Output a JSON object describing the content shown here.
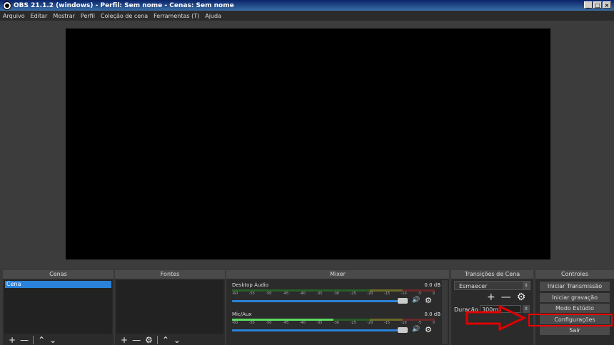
{
  "window": {
    "title": "OBS 21.1.2 (windows) - Perfil: Sem nome - Cenas: Sem nome"
  },
  "menu": [
    "Arquivo",
    "Editar",
    "Mostrar",
    "Perfil",
    "Coleção de cena",
    "Ferramentas (T)",
    "Ajuda"
  ],
  "docks": {
    "scenes": {
      "title": "Cenas",
      "items": [
        "Cena"
      ]
    },
    "sources": {
      "title": "Fontes"
    },
    "mixer": {
      "title": "Mixer",
      "ticks": [
        "-60",
        "-55",
        "-50",
        "-45",
        "-40",
        "-35",
        "-30",
        "-25",
        "-20",
        "-15",
        "-10",
        "-5",
        "0"
      ],
      "channels": [
        {
          "name": "Desktop Áudio",
          "db": "0.0 dB"
        },
        {
          "name": "Mic/Aux",
          "db": "0.0 dB"
        }
      ]
    },
    "transitions": {
      "title": "Transições de Cena",
      "selected": "Esmaecer",
      "duration_label": "Duração",
      "duration_value": "300ms"
    },
    "controls": {
      "title": "Controles",
      "buttons": [
        "Iniciar Transmissão",
        "Iniciar gravação",
        "Modo Estúdio",
        "Configurações",
        "Sair"
      ]
    }
  },
  "annotation": {
    "color": "#e00000"
  }
}
